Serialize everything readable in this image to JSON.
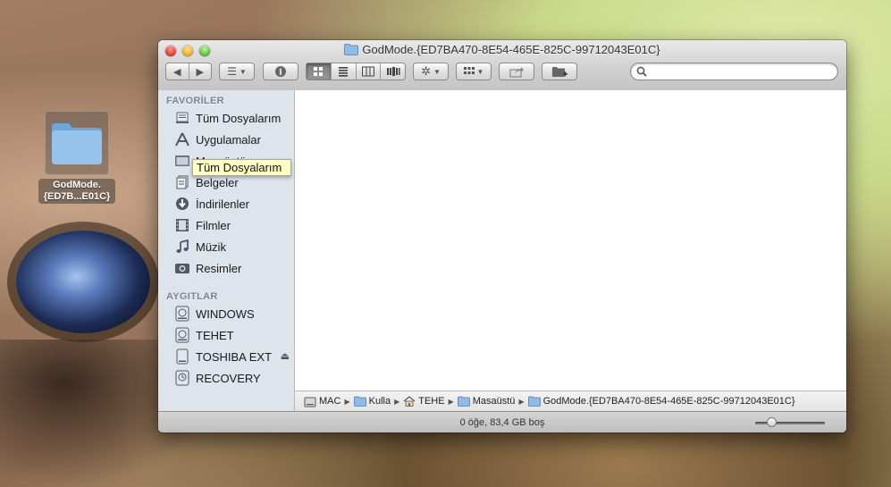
{
  "desktop": {
    "folder_label_line1": "GodMode.",
    "folder_label_line2": "{ED7B...E01C}"
  },
  "window": {
    "title": "GodMode.{ED7BA470-8E54-465E-825C-99712043E01C}",
    "search": {
      "value": "",
      "placeholder": ""
    }
  },
  "sidebar": {
    "favorites_header": "FAVORİLER",
    "favorites": [
      {
        "label": "Tüm Dosyalarım",
        "icon": "all-files-icon"
      },
      {
        "label": "Uygulamalar",
        "icon": "applications-icon"
      },
      {
        "label": "Masaüstü",
        "icon": "desktop-icon"
      },
      {
        "label": "Belgeler",
        "icon": "documents-icon"
      },
      {
        "label": "İndirilenler",
        "icon": "downloads-icon"
      },
      {
        "label": "Filmler",
        "icon": "movies-icon"
      },
      {
        "label": "Müzik",
        "icon": "music-icon"
      },
      {
        "label": "Resimler",
        "icon": "pictures-icon"
      }
    ],
    "devices_header": "AYGITLAR",
    "devices": [
      {
        "label": "WINDOWS",
        "icon": "disk-icon"
      },
      {
        "label": "TEHET",
        "icon": "disk-icon"
      },
      {
        "label": "TOSHIBA EXT",
        "icon": "external-disk-icon",
        "eject": "⏏"
      },
      {
        "label": "RECOVERY",
        "icon": "recovery-disk-icon"
      }
    ],
    "tooltip": "Tüm Dosyalarım"
  },
  "pathbar": [
    "MAC",
    "Kulla",
    "TEHE",
    "Masaüstü",
    "GodMode.{ED7BA470-8E54-465E-825C-99712043E01C}"
  ],
  "status": {
    "text": "0 öğe, 83,4 GB boş",
    "icon_size": 0.2
  }
}
